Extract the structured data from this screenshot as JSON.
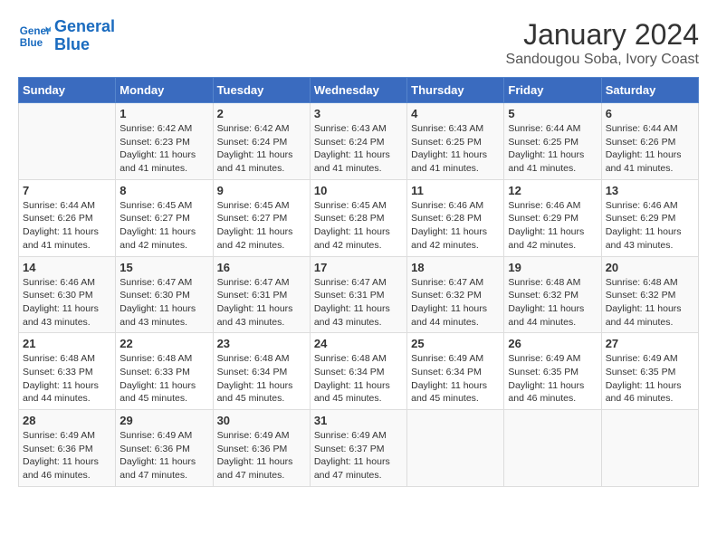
{
  "logo": {
    "line1": "General",
    "line2": "Blue"
  },
  "title": "January 2024",
  "location": "Sandougou Soba, Ivory Coast",
  "days_of_week": [
    "Sunday",
    "Monday",
    "Tuesday",
    "Wednesday",
    "Thursday",
    "Friday",
    "Saturday"
  ],
  "weeks": [
    [
      {
        "day": "",
        "sunrise": "",
        "sunset": "",
        "daylight": ""
      },
      {
        "day": "1",
        "sunrise": "Sunrise: 6:42 AM",
        "sunset": "Sunset: 6:23 PM",
        "daylight": "Daylight: 11 hours and 41 minutes."
      },
      {
        "day": "2",
        "sunrise": "Sunrise: 6:42 AM",
        "sunset": "Sunset: 6:24 PM",
        "daylight": "Daylight: 11 hours and 41 minutes."
      },
      {
        "day": "3",
        "sunrise": "Sunrise: 6:43 AM",
        "sunset": "Sunset: 6:24 PM",
        "daylight": "Daylight: 11 hours and 41 minutes."
      },
      {
        "day": "4",
        "sunrise": "Sunrise: 6:43 AM",
        "sunset": "Sunset: 6:25 PM",
        "daylight": "Daylight: 11 hours and 41 minutes."
      },
      {
        "day": "5",
        "sunrise": "Sunrise: 6:44 AM",
        "sunset": "Sunset: 6:25 PM",
        "daylight": "Daylight: 11 hours and 41 minutes."
      },
      {
        "day": "6",
        "sunrise": "Sunrise: 6:44 AM",
        "sunset": "Sunset: 6:26 PM",
        "daylight": "Daylight: 11 hours and 41 minutes."
      }
    ],
    [
      {
        "day": "7",
        "sunrise": "Sunrise: 6:44 AM",
        "sunset": "Sunset: 6:26 PM",
        "daylight": "Daylight: 11 hours and 41 minutes."
      },
      {
        "day": "8",
        "sunrise": "Sunrise: 6:45 AM",
        "sunset": "Sunset: 6:27 PM",
        "daylight": "Daylight: 11 hours and 42 minutes."
      },
      {
        "day": "9",
        "sunrise": "Sunrise: 6:45 AM",
        "sunset": "Sunset: 6:27 PM",
        "daylight": "Daylight: 11 hours and 42 minutes."
      },
      {
        "day": "10",
        "sunrise": "Sunrise: 6:45 AM",
        "sunset": "Sunset: 6:28 PM",
        "daylight": "Daylight: 11 hours and 42 minutes."
      },
      {
        "day": "11",
        "sunrise": "Sunrise: 6:46 AM",
        "sunset": "Sunset: 6:28 PM",
        "daylight": "Daylight: 11 hours and 42 minutes."
      },
      {
        "day": "12",
        "sunrise": "Sunrise: 6:46 AM",
        "sunset": "Sunset: 6:29 PM",
        "daylight": "Daylight: 11 hours and 42 minutes."
      },
      {
        "day": "13",
        "sunrise": "Sunrise: 6:46 AM",
        "sunset": "Sunset: 6:29 PM",
        "daylight": "Daylight: 11 hours and 43 minutes."
      }
    ],
    [
      {
        "day": "14",
        "sunrise": "Sunrise: 6:46 AM",
        "sunset": "Sunset: 6:30 PM",
        "daylight": "Daylight: 11 hours and 43 minutes."
      },
      {
        "day": "15",
        "sunrise": "Sunrise: 6:47 AM",
        "sunset": "Sunset: 6:30 PM",
        "daylight": "Daylight: 11 hours and 43 minutes."
      },
      {
        "day": "16",
        "sunrise": "Sunrise: 6:47 AM",
        "sunset": "Sunset: 6:31 PM",
        "daylight": "Daylight: 11 hours and 43 minutes."
      },
      {
        "day": "17",
        "sunrise": "Sunrise: 6:47 AM",
        "sunset": "Sunset: 6:31 PM",
        "daylight": "Daylight: 11 hours and 43 minutes."
      },
      {
        "day": "18",
        "sunrise": "Sunrise: 6:47 AM",
        "sunset": "Sunset: 6:32 PM",
        "daylight": "Daylight: 11 hours and 44 minutes."
      },
      {
        "day": "19",
        "sunrise": "Sunrise: 6:48 AM",
        "sunset": "Sunset: 6:32 PM",
        "daylight": "Daylight: 11 hours and 44 minutes."
      },
      {
        "day": "20",
        "sunrise": "Sunrise: 6:48 AM",
        "sunset": "Sunset: 6:32 PM",
        "daylight": "Daylight: 11 hours and 44 minutes."
      }
    ],
    [
      {
        "day": "21",
        "sunrise": "Sunrise: 6:48 AM",
        "sunset": "Sunset: 6:33 PM",
        "daylight": "Daylight: 11 hours and 44 minutes."
      },
      {
        "day": "22",
        "sunrise": "Sunrise: 6:48 AM",
        "sunset": "Sunset: 6:33 PM",
        "daylight": "Daylight: 11 hours and 45 minutes."
      },
      {
        "day": "23",
        "sunrise": "Sunrise: 6:48 AM",
        "sunset": "Sunset: 6:34 PM",
        "daylight": "Daylight: 11 hours and 45 minutes."
      },
      {
        "day": "24",
        "sunrise": "Sunrise: 6:48 AM",
        "sunset": "Sunset: 6:34 PM",
        "daylight": "Daylight: 11 hours and 45 minutes."
      },
      {
        "day": "25",
        "sunrise": "Sunrise: 6:49 AM",
        "sunset": "Sunset: 6:34 PM",
        "daylight": "Daylight: 11 hours and 45 minutes."
      },
      {
        "day": "26",
        "sunrise": "Sunrise: 6:49 AM",
        "sunset": "Sunset: 6:35 PM",
        "daylight": "Daylight: 11 hours and 46 minutes."
      },
      {
        "day": "27",
        "sunrise": "Sunrise: 6:49 AM",
        "sunset": "Sunset: 6:35 PM",
        "daylight": "Daylight: 11 hours and 46 minutes."
      }
    ],
    [
      {
        "day": "28",
        "sunrise": "Sunrise: 6:49 AM",
        "sunset": "Sunset: 6:36 PM",
        "daylight": "Daylight: 11 hours and 46 minutes."
      },
      {
        "day": "29",
        "sunrise": "Sunrise: 6:49 AM",
        "sunset": "Sunset: 6:36 PM",
        "daylight": "Daylight: 11 hours and 47 minutes."
      },
      {
        "day": "30",
        "sunrise": "Sunrise: 6:49 AM",
        "sunset": "Sunset: 6:36 PM",
        "daylight": "Daylight: 11 hours and 47 minutes."
      },
      {
        "day": "31",
        "sunrise": "Sunrise: 6:49 AM",
        "sunset": "Sunset: 6:37 PM",
        "daylight": "Daylight: 11 hours and 47 minutes."
      },
      {
        "day": "",
        "sunrise": "",
        "sunset": "",
        "daylight": ""
      },
      {
        "day": "",
        "sunrise": "",
        "sunset": "",
        "daylight": ""
      },
      {
        "day": "",
        "sunrise": "",
        "sunset": "",
        "daylight": ""
      }
    ]
  ]
}
